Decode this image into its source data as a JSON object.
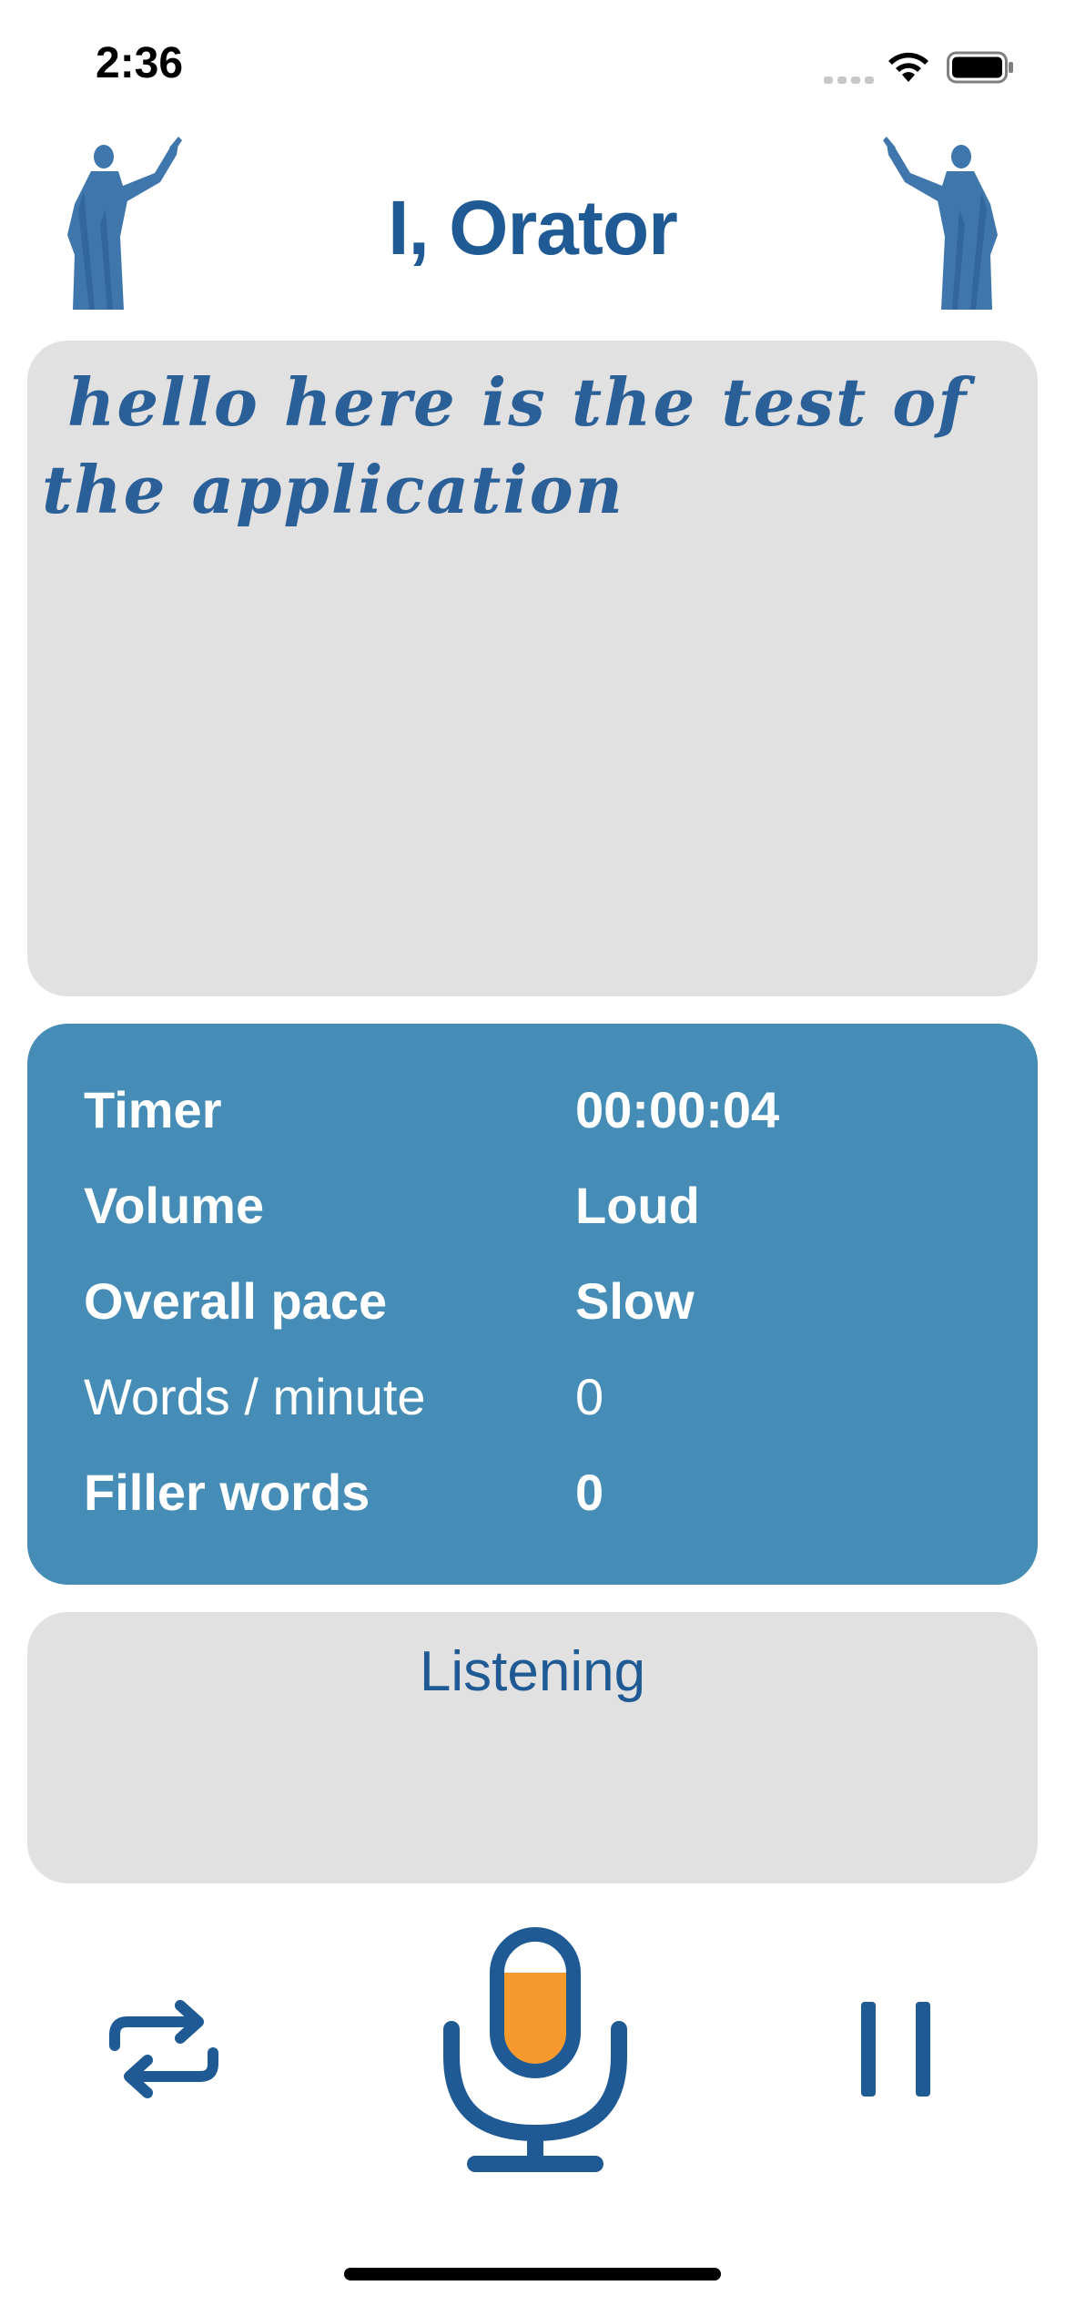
{
  "status_bar": {
    "time": "2:36",
    "icons": [
      "signal-icon",
      "wifi-icon",
      "battery-icon"
    ]
  },
  "header": {
    "title": "I, Orator",
    "icons": [
      "statue-left-icon",
      "statue-right-icon"
    ]
  },
  "transcript": {
    "text": "hello here is the test of the application"
  },
  "stats": {
    "timer": {
      "label": "Timer",
      "value": "00:00:04"
    },
    "volume": {
      "label": "Volume",
      "value": "Loud"
    },
    "overall_pace": {
      "label": "Overall pace",
      "value": "Slow"
    },
    "words_per_minute": {
      "label": "Words / minute",
      "value": "0"
    },
    "filler_words": {
      "label": "Filler words",
      "value": "0"
    }
  },
  "listening": {
    "status": "Listening"
  },
  "controls": {
    "icons": [
      "repeat-icon",
      "microphone-icon",
      "pause-icon"
    ],
    "mic_level_percent": 72
  },
  "colors": {
    "brand_blue": "#1f5a94",
    "stats_panel": "#458db6",
    "panel_gray": "#e1e1e1",
    "mic_fill_orange": "#f79a2e"
  }
}
